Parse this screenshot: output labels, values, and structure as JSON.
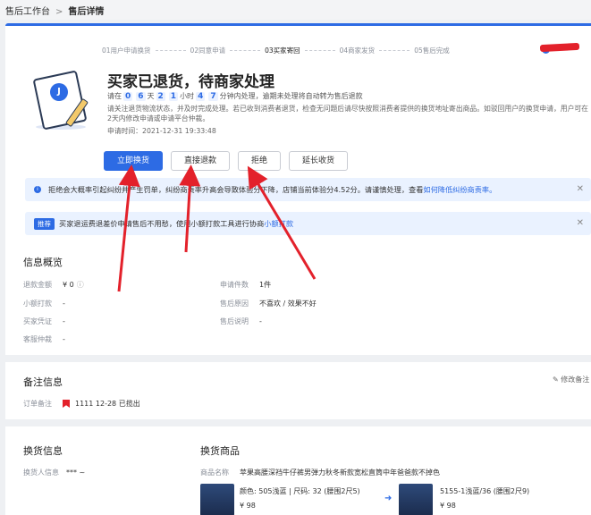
{
  "breadcrumb": {
    "root": "售后工作台",
    "current": "售后详情"
  },
  "steps": [
    "01用户申请换货",
    "02同意申请",
    "03买家寄回",
    "04商家发货",
    "05售后完成"
  ],
  "status": {
    "title": "买家已退货，待商家处理",
    "countdown_prefix": "请在",
    "d_tens": "0",
    "d_units": "6",
    "day_label": "天",
    "h_tens": "2",
    "h_units": "1",
    "hour_label": "小时",
    "m_tens": "4",
    "m_units": "7",
    "countdown_suffix": "分钟内处理，逾期未处理将自动转为售后退款",
    "notice": "请关注退货物流状态，并及时完成处理。若已收到消费者退货，检查无问题后请尽快按照消费者提供的换货地址寄出商品。如驳回用户的换货申请，用户可在2天内修改申请或申请平台仲裁。",
    "apply_time_label": "申请时间：",
    "apply_time": "2021-12-31 19:33:48"
  },
  "actions": {
    "exchange": "立即换货",
    "refund": "直接退款",
    "reject": "拒绝",
    "extend": "延长收货"
  },
  "alert1": {
    "text": "拒绝会大概率引起纠纷并产生罚单，纠纷商责率升高会导致体验分下降，店铺当前体验分4.52分。请谨慎处理，查看",
    "link": "如何降低纠纷商责率。"
  },
  "alert2": {
    "tag": "推荐",
    "text": "买家退运费退差价申请售后不用愁，使用小额打款工具进行协商",
    "link": "小额打款"
  },
  "overview": {
    "title": "信息概览",
    "refund_label": "退款金额",
    "refund_value": "¥ 0",
    "small_pay_label": "小额打款",
    "small_pay_value": "-",
    "proof_label": "买家凭证",
    "proof_value": "-",
    "arbitration_label": "客服仲裁",
    "arbitration_value": "-",
    "count_label": "申请件数",
    "count_value": "1件",
    "reason_label": "售后原因",
    "reason_value": "不喜欢 / 效果不好",
    "desc_label": "售后说明",
    "desc_value": "-"
  },
  "remark": {
    "title": "备注信息",
    "edit": "修改备注",
    "order_label": "订单备注",
    "order_value": "1111 12-28 已揽出"
  },
  "exchange_info": {
    "title": "换货信息",
    "person_label": "换货人信息",
    "person_value": "*** ~"
  },
  "exchange_goods": {
    "title": "换货商品",
    "name_label": "商品名称",
    "name_value": "苹果高腰深裆牛仔裤男弹力秋冬新款宽松直筒中年爸爸款不掉色",
    "left_spec": "颜色: 505浅蓝 | 尺码: 32 (腰围2尺5)",
    "left_price": "¥ 98",
    "right_spec": "5155-1浅蓝/36 (腰围2尺9)",
    "right_price": "¥ 98"
  }
}
